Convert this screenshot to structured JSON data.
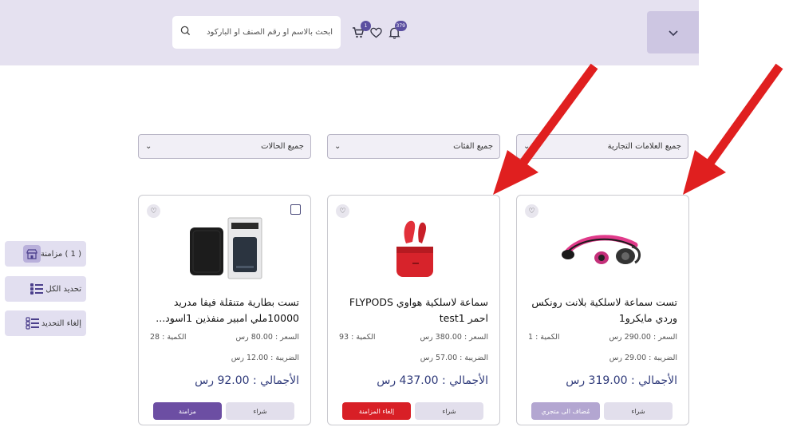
{
  "header": {
    "search_placeholder": "ابحث بالاسم أو رقم الصنف أو الباركود",
    "cart_badge": "1",
    "notifications_badge": "379"
  },
  "filters": {
    "brands": "جميع العلامات التجارية",
    "categories": "جميع الفئات",
    "statuses": "جميع الحالات"
  },
  "sidebar": {
    "sync": "( 1 ) مزامنة",
    "select_all": "تحديد الكل",
    "deselect": "إلغاء التحديد"
  },
  "products": [
    {
      "title": "تست سماعة لاسلكية بلانت رونكس وردي مايكرو1",
      "price": "السعر : 290.00 رس",
      "quantity": "الكمية : 1",
      "tax": "الضريبة : 29.00 رس",
      "total": "الأجمالي : 319.00 رس",
      "buy": "شراء",
      "action": "مُضاف الى متجري"
    },
    {
      "title": "سماعة لاسلكية هواوي FLYPODS احمر test1",
      "price": "السعر : 380.00 رس",
      "quantity": "الكمية : 93",
      "tax": "الضريبة : 57.00 رس",
      "total": "الأجمالي : 437.00 رس",
      "buy": "شراء",
      "action": "إلغاء المزامنة"
    },
    {
      "title": "تست بطارية متنقلة فيفا مدريد 10000ملي امبير منفذين 1اسود...",
      "price": "السعر : 80.00 رس",
      "quantity": "الكمية : 28",
      "tax": "الضريبة : 12.00 رس",
      "total": "الأجمالي : 92.00 رس",
      "buy": "شراء",
      "action": "مزامنة"
    }
  ],
  "icons": {
    "menu": "chevron-down-icon",
    "search": "search-icon",
    "cart": "cart-icon",
    "heart": "heart-icon",
    "bell": "bell-icon"
  },
  "colors": {
    "header_bg": "#e5e1f0",
    "primary_purple": "#6c4ea3",
    "danger_red": "#d81f26",
    "annotation_red": "#e01f1f"
  }
}
